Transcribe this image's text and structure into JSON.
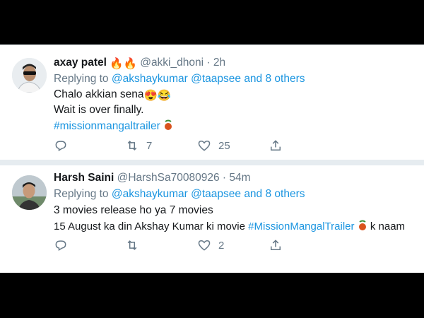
{
  "colors": {
    "link": "#1b95e0",
    "muted": "#657786",
    "text": "#14171a",
    "divider": "#e6ecf0"
  },
  "tweets": [
    {
      "name": "axay patel",
      "name_emoji": "🔥🔥",
      "handle": "@akki_dhoni",
      "sep": "·",
      "time": "2h",
      "replying_prefix": "Replying to",
      "mention1": "@akshaykumar",
      "mention2": "@taapsee",
      "and_others": "and",
      "others_link": "8 others",
      "lines": [
        "Chalo akkian sena",
        "Wait is over finally."
      ],
      "line1_emoji": "😍😂",
      "hashtag": "#missionmangaltrailer",
      "retweets": "7",
      "likes": "25"
    },
    {
      "name": "Harsh Saini",
      "handle": "@HarshSa70080926",
      "sep": "·",
      "time": "54m",
      "replying_prefix": "Replying to",
      "mention1": "@akshaykumar",
      "mention2": "@taapsee",
      "and_others": "and",
      "others_link": "8 others",
      "line1": "3 movies release ho ya 7 movies",
      "line2_prefix": "15 August ka din Akshay Kumar ki movie",
      "hashtag": "#MissionMangalTrailer",
      "line2_suffix": "k naam",
      "retweets": "",
      "likes": "2"
    }
  ]
}
